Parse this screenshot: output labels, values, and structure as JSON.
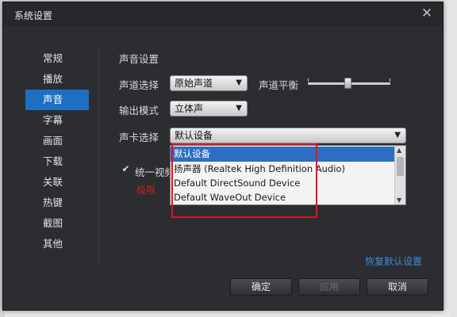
{
  "window": {
    "title": "系统设置"
  },
  "sidebar": {
    "items": [
      {
        "label": "常规"
      },
      {
        "label": "播放"
      },
      {
        "label": "声音",
        "active": true
      },
      {
        "label": "字幕"
      },
      {
        "label": "画面"
      },
      {
        "label": "下载"
      },
      {
        "label": "关联"
      },
      {
        "label": "热键"
      },
      {
        "label": "截图"
      },
      {
        "label": "其他"
      }
    ]
  },
  "sound": {
    "section_title": "声音设置",
    "channel_label": "声道选择",
    "channel_value": "原始声道",
    "balance_label": "声道平衡",
    "output_label": "输出模式",
    "output_value": "立体声",
    "card_label": "声卡选择",
    "card_value": "默认设备",
    "card_options": [
      "默认设备",
      "扬声器 (Realtek High Definition Audio)",
      "Default DirectSound Device",
      "Default WaveOut Device"
    ],
    "unify_label": "统一视频",
    "note": "极限"
  },
  "footer": {
    "restore_label": "恢复默认设置",
    "ok_label": "确定",
    "apply_label": "应用",
    "cancel_label": "取消"
  },
  "colors": {
    "accent": "#1e6fc1",
    "highlight_box": "#e0141e",
    "link": "#3f8ad8"
  },
  "icons": {
    "close": "close-icon",
    "dropdown": "chevron-down-icon",
    "check": "checkmark-icon"
  }
}
